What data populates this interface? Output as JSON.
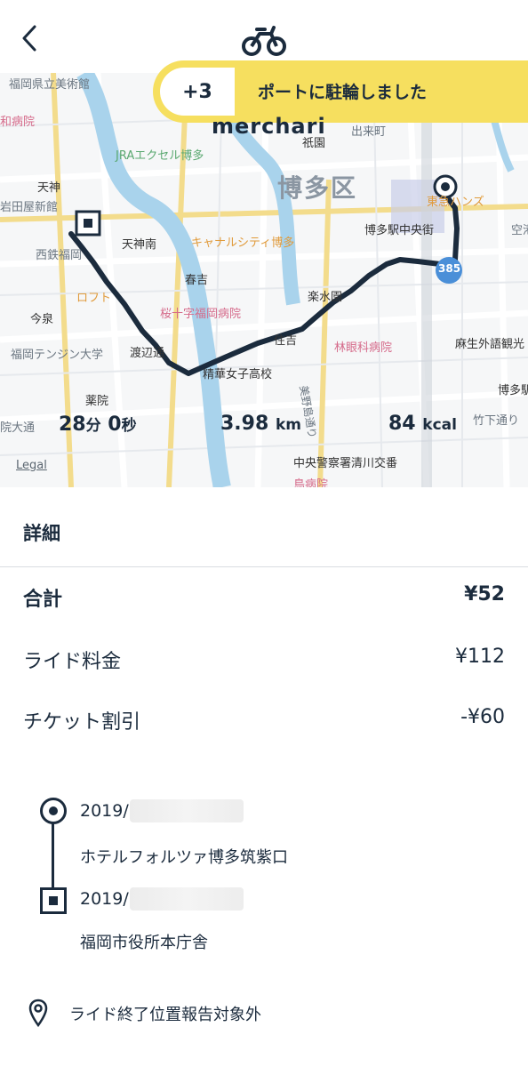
{
  "header": {
    "back_icon": "chevron-left-icon",
    "logo_icon": "bicycle-icon"
  },
  "banner": {
    "points": "+3",
    "message": "ポートに駐輪しました"
  },
  "map": {
    "brand": "merchari",
    "legal": "Legal",
    "labels": {
      "l1": "福岡県立美術館",
      "l2": "JRAエクセル博多",
      "l3": "祇園",
      "l4": "出来町",
      "l5": "博多区",
      "l6": "天神",
      "l7": "岩田屋新館",
      "l8": "天神南",
      "l9": "西鉄福岡",
      "l10": "キャナルシティ博多",
      "l11": "博多駅中央街",
      "l12": "東急ハンズ",
      "l13": "春吉",
      "l14": "ロフト",
      "l15": "楽水園",
      "l16": "桜十字福岡病院",
      "l17": "今泉",
      "l18": "林眼科病院",
      "l19": "福岡テンジン大学",
      "l20": "渡辺通",
      "l21": "住吉",
      "l22": "精華女子高校",
      "l23": "麻生外語観光",
      "l24": "薬院",
      "l25": "院大通",
      "l26": "竹下通り",
      "l27": "博多駅",
      "l28": "中央警察署清川交番",
      "l29": "和病院",
      "l30": "鳥病院",
      "l31": "385",
      "l32": "美野島通り",
      "l33": "空港"
    },
    "stats": {
      "time_min": "28",
      "time_min_unit": "分",
      "time_sec": " 0",
      "time_sec_unit": "秒",
      "distance": "3.98",
      "distance_unit": "km",
      "calories": "84",
      "calories_unit": "kcal"
    }
  },
  "details": {
    "title": "詳細",
    "total_label": "合計",
    "total_value": "¥52",
    "ride_fee_label": "ライド料金",
    "ride_fee_value": "¥112",
    "ticket_label": "チケット割引",
    "ticket_value": "-¥60"
  },
  "timeline": {
    "start_date": "2019/",
    "start_place": "ホテルフォルツァ博多筑紫口",
    "end_date": "2019/",
    "end_place": "福岡市役所本庁舎"
  },
  "report": {
    "text": "ライド終了位置報告対象外"
  }
}
